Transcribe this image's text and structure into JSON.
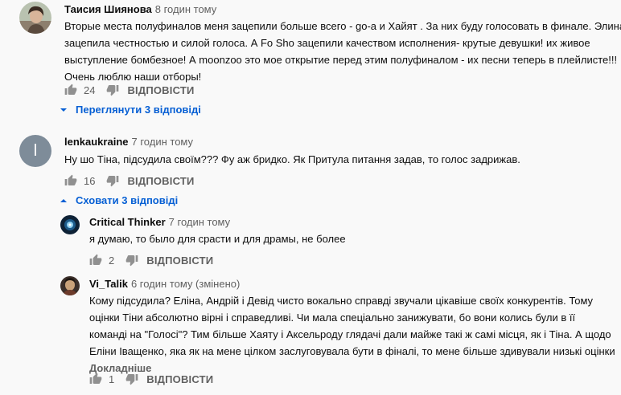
{
  "comments": [
    {
      "author": "Таисия Шиянова",
      "time": "8 годин тому",
      "lines": [
        "Вторые места полуфиналов меня зацепили больше всего - go-a и Хайят . За них буду голосовать в финале. Элина",
        "зацепила честностью и силой голоса. А Fo Sho зацепили качеством исполнения- крутые девушки! их живое",
        "выступление бомбезное! А moonzoo это мое открытие перед этим полуфиналом - их песни теперь в плейлисте!!!",
        "Очень люблю наши отборы!"
      ],
      "likes": "24",
      "reply_label": "ВІДПОВІСТИ",
      "toggle_label": "Переглянути 3 відповіді"
    },
    {
      "author": "lenkaukraine",
      "time": "7 годин тому",
      "avatar_letter": "l",
      "avatar_color": "#7e8c99",
      "lines": [
        "Ну шо Тіна, підсудила своїм??? Фу аж бридко.  Як Притула питання задав, то голос задрижав."
      ],
      "likes": "16",
      "reply_label": "ВІДПОВІСТИ",
      "toggle_label": "Сховати 3 відповіді"
    }
  ],
  "replies": [
    {
      "author": "Critical Thinker",
      "time": "7 годин тому",
      "lines": [
        "я думаю, то было для срасти и для драмы, не более"
      ],
      "likes": "2",
      "reply_label": "ВІДПОВІСТИ"
    },
    {
      "author": "Vi_Talik",
      "time": "6 годин тому (змінено)",
      "lines": [
        "Кому підсудила? Еліна, Андрій і Девід чисто вокально справді звучали цікавіше своїх конкурентів. Тому",
        "оцінки Тіни абсолютно вірні і справедливі. Чи мала спеціально занижувати, бо вони колись були в її",
        "команді на \"Голосі\"? Тим більше Хаяту і Аксельроду глядачі дали майже такі ж самі місця, як і Тіна. А щодо",
        "Еліни Іващенко, яка як на мене цілком заслуговувала бути в фіналі, то мене більше здивували низькі оцінки"
      ],
      "read_more": "Докладніше",
      "likes": "1",
      "reply_label": "ВІДПОВІСТИ"
    }
  ],
  "icons": {
    "like": "thumbs-up-icon",
    "dislike": "thumbs-down-icon",
    "expand": "chevron-down-icon",
    "collapse": "chevron-up-icon"
  },
  "colors": {
    "link_blue": "#065fd4",
    "meta_grey": "#606060",
    "background": "#f9f9f9"
  }
}
